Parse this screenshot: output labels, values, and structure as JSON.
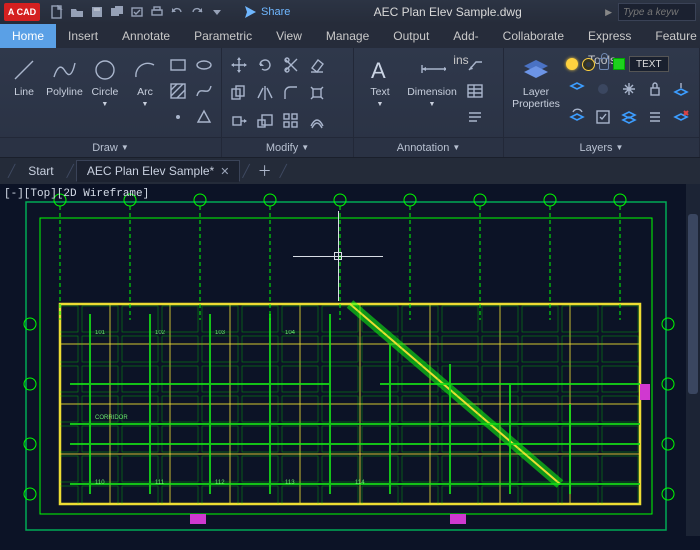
{
  "app": {
    "brand": "A CAD"
  },
  "title": "AEC Plan Elev Sample.dwg",
  "search_placeholder": "Type a keyw",
  "share_label": "Share",
  "ribbon": {
    "tabs": [
      "Home",
      "Insert",
      "Annotate",
      "Parametric",
      "View",
      "Manage",
      "Output",
      "Add-ins",
      "Collaborate",
      "Express Tools",
      "Feature"
    ],
    "active_tab": "Home",
    "panels": {
      "draw": {
        "title": "Draw",
        "items": {
          "line": "Line",
          "polyline": "Polyline",
          "circle": "Circle",
          "arc": "Arc"
        }
      },
      "modify": {
        "title": "Modify"
      },
      "annot": {
        "title": "Annotation",
        "text": "Text",
        "dimension": "Dimension"
      },
      "layers": {
        "title": "Layers",
        "layer_properties": "Layer\nProperties",
        "current_layer": "TEXT"
      }
    }
  },
  "file_tabs": {
    "items": [
      {
        "label": "Start",
        "dirty": false,
        "active": false
      },
      {
        "label": "AEC Plan Elev Sample*",
        "dirty": true,
        "active": true
      }
    ]
  },
  "viewport": {
    "controls": "[-][Top][2D Wireframe]"
  }
}
